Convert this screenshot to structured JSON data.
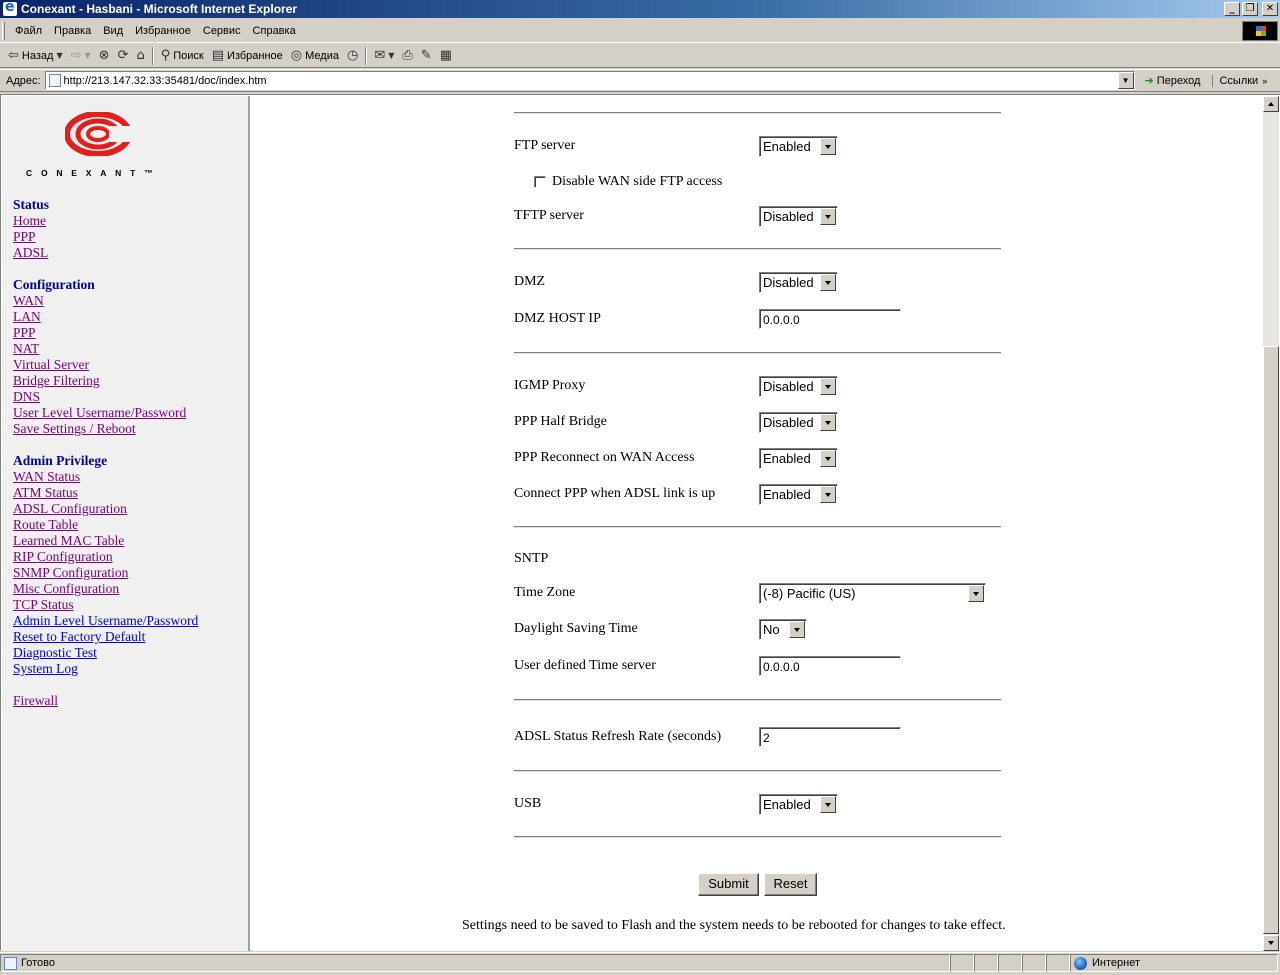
{
  "window": {
    "title": "Conexant - Hasbani - Microsoft Internet Explorer"
  },
  "menubar": {
    "items": [
      "Файл",
      "Правка",
      "Вид",
      "Избранное",
      "Сервис",
      "Справка"
    ]
  },
  "toolbar": {
    "back": "Назад",
    "search": "Поиск",
    "favorites": "Избранное",
    "media": "Медиа"
  },
  "address": {
    "label": "Адрес:",
    "url": "http://213.147.32.33:35481/doc/index.htm",
    "go": "Переход",
    "links": "Ссылки"
  },
  "sidebar": {
    "logo_text": "CONEXANT™",
    "status": {
      "heading": "Status",
      "links": [
        "Home",
        "PPP",
        "ADSL"
      ]
    },
    "configuration": {
      "heading": "Configuration",
      "links": [
        "WAN",
        "LAN",
        "PPP",
        "NAT",
        "Virtual Server",
        "Bridge Filtering",
        "DNS",
        "User Level Username/Password",
        "Save Settings / Reboot"
      ]
    },
    "admin": {
      "heading": "Admin Privilege",
      "links": [
        "WAN Status",
        "ATM Status",
        "ADSL Configuration",
        "Route Table",
        "Learned MAC Table",
        "RIP Configuration",
        "SNMP Configuration",
        "Misc Configuration",
        "TCP Status",
        "Admin Level Username/Password",
        "Reset to Factory Default",
        "Diagnostic Test",
        "System Log"
      ]
    },
    "firewall": "Firewall"
  },
  "form": {
    "ftp_server": {
      "label": "FTP server",
      "value": "Enabled"
    },
    "disable_wan_ftp": {
      "label": "Disable WAN side FTP access",
      "checked": false
    },
    "tftp_server": {
      "label": "TFTP server",
      "value": "Disabled"
    },
    "dmz": {
      "label": "DMZ",
      "value": "Disabled"
    },
    "dmz_host_ip": {
      "label": "DMZ HOST IP",
      "value": "0.0.0.0"
    },
    "igmp_proxy": {
      "label": "IGMP Proxy",
      "value": "Disabled"
    },
    "ppp_half_bridge": {
      "label": "PPP Half Bridge",
      "value": "Disabled"
    },
    "ppp_reconnect": {
      "label": "PPP Reconnect on WAN Access",
      "value": "Enabled"
    },
    "connect_ppp": {
      "label": "Connect PPP when ADSL link is up",
      "value": "Enabled"
    },
    "sntp": {
      "heading": "SNTP"
    },
    "time_zone": {
      "label": "Time Zone",
      "value": "(-8) Pacific (US)"
    },
    "daylight_saving": {
      "label": "Daylight Saving Time",
      "value": "No"
    },
    "time_server": {
      "label": "User defined Time server",
      "value": "0.0.0.0"
    },
    "adsl_refresh": {
      "label": "ADSL Status Refresh Rate (seconds)",
      "value": "2"
    },
    "usb": {
      "label": "USB",
      "value": "Enabled"
    },
    "submit": "Submit",
    "reset": "Reset",
    "note": "Settings need to be saved to Flash and the system needs to be rebooted for changes to take effect."
  },
  "statusbar": {
    "status": "Готово",
    "zone": "Интернет"
  }
}
